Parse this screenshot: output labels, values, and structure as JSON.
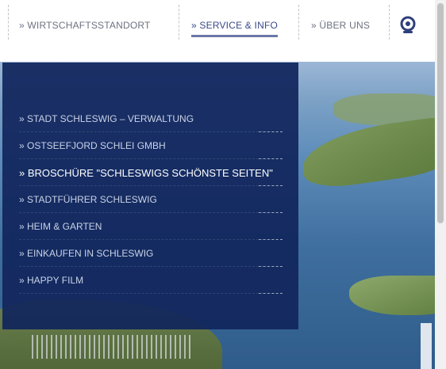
{
  "nav": {
    "items": [
      {
        "label": "» WIRTSCHAFTSSTANDORT",
        "active": false
      },
      {
        "label": "» SERVICE & INFO",
        "active": true
      },
      {
        "label": "» ÜBER UNS",
        "active": false
      }
    ],
    "camera_icon": "webcam-icon",
    "active_color": "#3a4a8a"
  },
  "dropdown": {
    "background": "#11265c",
    "items": [
      {
        "label": "» STADT SCHLESWIG – VERWALTUNG"
      },
      {
        "label": "» OSTSEEFJORD SCHLEI GMBH"
      },
      {
        "label": "» BROSCHÜRE \"SCHLESWIGS SCHÖNSTE SEITEN\""
      },
      {
        "label": "» STADTFÜHRER SCHLESWIG"
      },
      {
        "label": "» HEIM & GARTEN"
      },
      {
        "label": "» EINKAUFEN IN SCHLESWIG"
      },
      {
        "label": "» HAPPY FILM"
      }
    ]
  }
}
